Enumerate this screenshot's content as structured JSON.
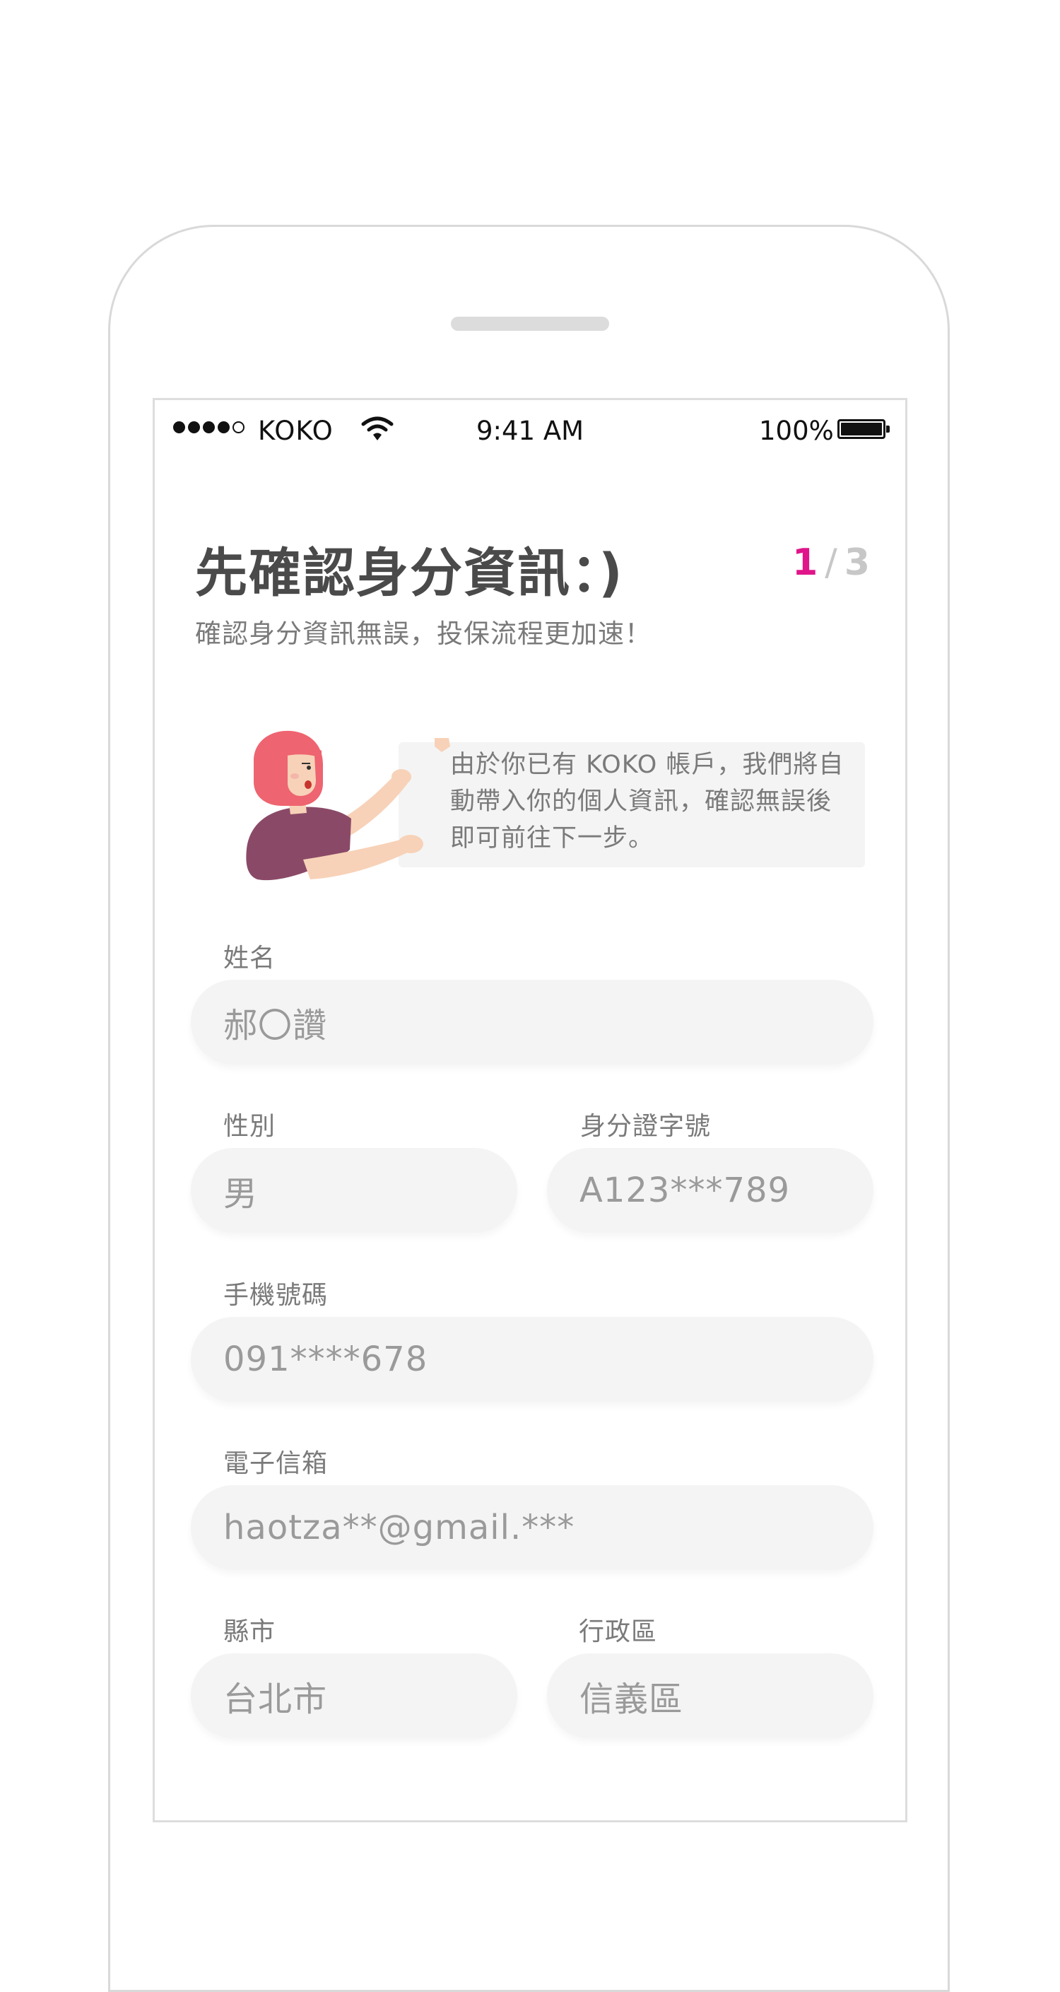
{
  "status_bar": {
    "carrier": "KOKO",
    "time": "9:41 AM",
    "battery": "100%",
    "signal_icon": "signal-dots-icon",
    "wifi_icon": "wifi-icon",
    "battery_icon": "battery-icon"
  },
  "header": {
    "title": "先確認身分資訊：)",
    "subtitle": "確認身分資訊無誤，投保流程更加速！",
    "step_current": "1",
    "step_separator": "/",
    "step_total": "3"
  },
  "note": {
    "text": "由於你已有 KOKO 帳戶，我們將自動帶入你的個人資訊，確認無誤後即可前往下一步。",
    "illustration": "woman-holding-sign-illustration"
  },
  "form": {
    "name": {
      "label": "姓名",
      "value": "郝〇讚"
    },
    "gender": {
      "label": "性別",
      "value": "男"
    },
    "id_number": {
      "label": "身分證字號",
      "value": "A123***789"
    },
    "phone": {
      "label": "手機號碼",
      "value": "091****678"
    },
    "email": {
      "label": "電子信箱",
      "value": "haotza**@gmail.***"
    },
    "city": {
      "label": "縣市",
      "value": "台北市"
    },
    "district": {
      "label": "行政區",
      "value": "信義區"
    }
  },
  "colors": {
    "accent": "#e0158a",
    "title": "#4a4a4a",
    "muted": "#7a7a7a",
    "field_bg": "#f4f4f4"
  }
}
